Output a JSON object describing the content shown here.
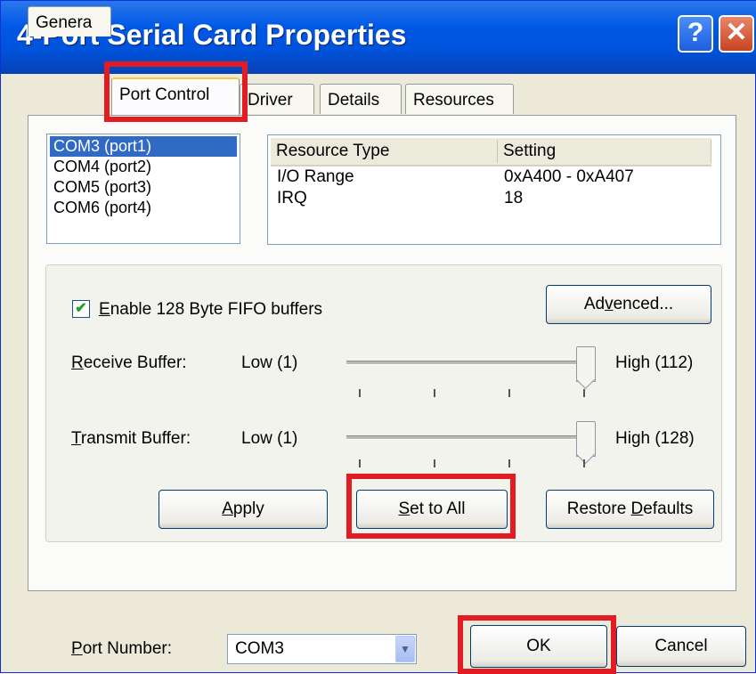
{
  "window": {
    "title": "4-Port Serial Card Properties",
    "help_glyph": "?",
    "close_glyph": "✕"
  },
  "tabs": [
    {
      "label": "Genera"
    },
    {
      "label": "Port Control"
    },
    {
      "label": "Driver"
    },
    {
      "label": "Details"
    },
    {
      "label": "Resources"
    }
  ],
  "ports": [
    {
      "label": "COM3 (port1)",
      "selected": true
    },
    {
      "label": "COM4 (port2)",
      "selected": false
    },
    {
      "label": "COM5 (port3)",
      "selected": false
    },
    {
      "label": "COM6 (port4)",
      "selected": false
    }
  ],
  "resources": {
    "headers": [
      "Resource Type",
      "Setting"
    ],
    "rows": [
      [
        "I/O Range",
        "0xA400 - 0xA407"
      ],
      [
        "IRQ",
        "18"
      ]
    ]
  },
  "fifo": {
    "checkbox_pre": "",
    "checkbox_ul": "E",
    "checkbox_post": "nable 128 Byte FIFO buffers",
    "checked": true,
    "advanced_pre": "Ad",
    "advanced_ul": "v",
    "advanced_post": "enced..."
  },
  "receive": {
    "label_ul": "R",
    "label_post": "eceive Buffer:",
    "low": "Low (1)",
    "high": "High (112)",
    "level": 1.0
  },
  "transmit": {
    "label_ul": "T",
    "label_post": "ransmit Buffer:",
    "low": "Low (1)",
    "high": "High (128)",
    "level": 1.0
  },
  "buttons": {
    "apply_ul": "A",
    "apply_post": "pply",
    "set_all_ul": "S",
    "set_all_post": "et to All",
    "restore_pre": "Restore ",
    "restore_ul": "D",
    "restore_post": "efaults",
    "ok": "OK",
    "cancel": "Cancel"
  },
  "port_number": {
    "label_ul": "P",
    "label_post": "ort Number:",
    "value": "COM3"
  },
  "colors": {
    "highlight": "#e31b23",
    "selection": "#316ac5",
    "titlebar": "#0058e6"
  }
}
